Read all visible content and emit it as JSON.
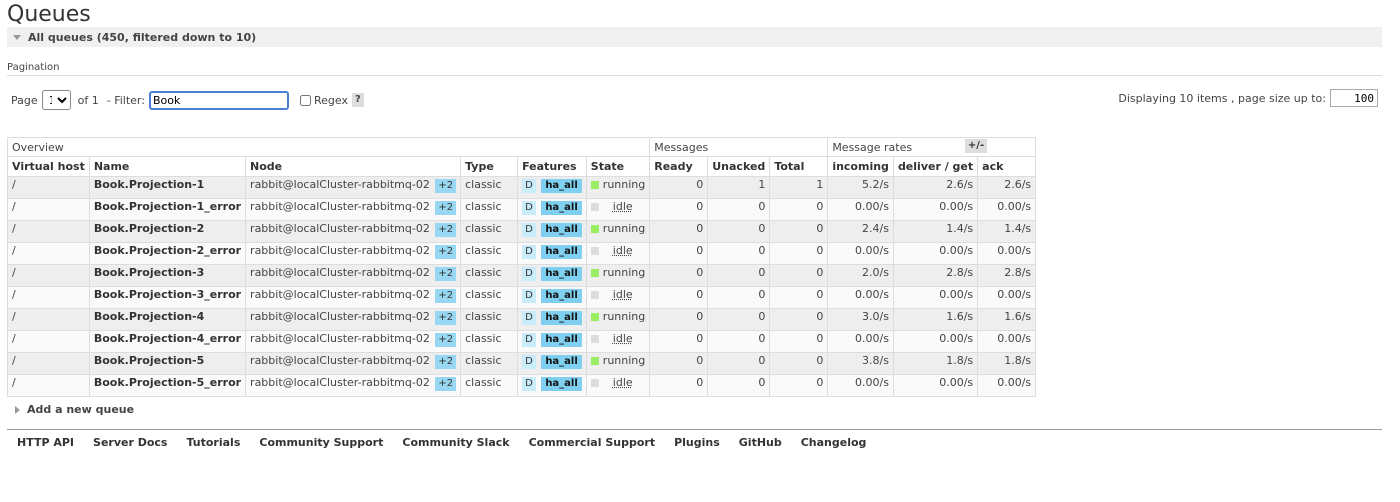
{
  "page_title": "Queues",
  "section_header": "All queues (450, filtered down to 10)",
  "pagination": {
    "label": "Pagination",
    "page_label": "Page",
    "page_value": "1",
    "of_label": "of 1",
    "filter_label": "- Filter:",
    "filter_value": "Book",
    "regex_label": "Regex",
    "help": "?",
    "display_text": "Displaying 10 items , page size up to:",
    "page_size": "100"
  },
  "table": {
    "groups": [
      "Overview",
      "Messages",
      "Message rates"
    ],
    "headers": [
      "Virtual host",
      "Name",
      "Node",
      "Type",
      "Features",
      "State",
      "Ready",
      "Unacked",
      "Total",
      "incoming",
      "deliver / get",
      "ack"
    ],
    "plus_minus": "+/-",
    "rows": [
      {
        "vhost": "/",
        "name": "Book.Projection-1",
        "node": "rabbit@localCluster-rabbitmq-02",
        "node_extra": "+2",
        "type": "classic",
        "feat_d": "D",
        "feat_ha": "ha_all",
        "state": "running",
        "ready": "0",
        "unacked": "1",
        "total": "1",
        "incoming": "5.2/s",
        "deliver": "2.6/s",
        "ack": "2.6/s"
      },
      {
        "vhost": "/",
        "name": "Book.Projection-1_error",
        "node": "rabbit@localCluster-rabbitmq-02",
        "node_extra": "+2",
        "type": "classic",
        "feat_d": "D",
        "feat_ha": "ha_all",
        "state": "idle",
        "ready": "0",
        "unacked": "0",
        "total": "0",
        "incoming": "0.00/s",
        "deliver": "0.00/s",
        "ack": "0.00/s"
      },
      {
        "vhost": "/",
        "name": "Book.Projection-2",
        "node": "rabbit@localCluster-rabbitmq-02",
        "node_extra": "+2",
        "type": "classic",
        "feat_d": "D",
        "feat_ha": "ha_all",
        "state": "running",
        "ready": "0",
        "unacked": "0",
        "total": "0",
        "incoming": "2.4/s",
        "deliver": "1.4/s",
        "ack": "1.4/s"
      },
      {
        "vhost": "/",
        "name": "Book.Projection-2_error",
        "node": "rabbit@localCluster-rabbitmq-02",
        "node_extra": "+2",
        "type": "classic",
        "feat_d": "D",
        "feat_ha": "ha_all",
        "state": "idle",
        "ready": "0",
        "unacked": "0",
        "total": "0",
        "incoming": "0.00/s",
        "deliver": "0.00/s",
        "ack": "0.00/s"
      },
      {
        "vhost": "/",
        "name": "Book.Projection-3",
        "node": "rabbit@localCluster-rabbitmq-02",
        "node_extra": "+2",
        "type": "classic",
        "feat_d": "D",
        "feat_ha": "ha_all",
        "state": "running",
        "ready": "0",
        "unacked": "0",
        "total": "0",
        "incoming": "2.0/s",
        "deliver": "2.8/s",
        "ack": "2.8/s"
      },
      {
        "vhost": "/",
        "name": "Book.Projection-3_error",
        "node": "rabbit@localCluster-rabbitmq-02",
        "node_extra": "+2",
        "type": "classic",
        "feat_d": "D",
        "feat_ha": "ha_all",
        "state": "idle",
        "ready": "0",
        "unacked": "0",
        "total": "0",
        "incoming": "0.00/s",
        "deliver": "0.00/s",
        "ack": "0.00/s"
      },
      {
        "vhost": "/",
        "name": "Book.Projection-4",
        "node": "rabbit@localCluster-rabbitmq-02",
        "node_extra": "+2",
        "type": "classic",
        "feat_d": "D",
        "feat_ha": "ha_all",
        "state": "running",
        "ready": "0",
        "unacked": "0",
        "total": "0",
        "incoming": "3.0/s",
        "deliver": "1.6/s",
        "ack": "1.6/s"
      },
      {
        "vhost": "/",
        "name": "Book.Projection-4_error",
        "node": "rabbit@localCluster-rabbitmq-02",
        "node_extra": "+2",
        "type": "classic",
        "feat_d": "D",
        "feat_ha": "ha_all",
        "state": "idle",
        "ready": "0",
        "unacked": "0",
        "total": "0",
        "incoming": "0.00/s",
        "deliver": "0.00/s",
        "ack": "0.00/s"
      },
      {
        "vhost": "/",
        "name": "Book.Projection-5",
        "node": "rabbit@localCluster-rabbitmq-02",
        "node_extra": "+2",
        "type": "classic",
        "feat_d": "D",
        "feat_ha": "ha_all",
        "state": "running",
        "ready": "0",
        "unacked": "0",
        "total": "0",
        "incoming": "3.8/s",
        "deliver": "1.8/s",
        "ack": "1.8/s"
      },
      {
        "vhost": "/",
        "name": "Book.Projection-5_error",
        "node": "rabbit@localCluster-rabbitmq-02",
        "node_extra": "+2",
        "type": "classic",
        "feat_d": "D",
        "feat_ha": "ha_all",
        "state": "idle",
        "ready": "0",
        "unacked": "0",
        "total": "0",
        "incoming": "0.00/s",
        "deliver": "0.00/s",
        "ack": "0.00/s"
      }
    ]
  },
  "state_colors": {
    "running": "#99ee66",
    "idle": "#dddddd"
  },
  "add_queue_label": "Add a new queue",
  "footer_links": [
    "HTTP API",
    "Server Docs",
    "Tutorials",
    "Community Support",
    "Community Slack",
    "Commercial Support",
    "Plugins",
    "GitHub",
    "Changelog"
  ]
}
